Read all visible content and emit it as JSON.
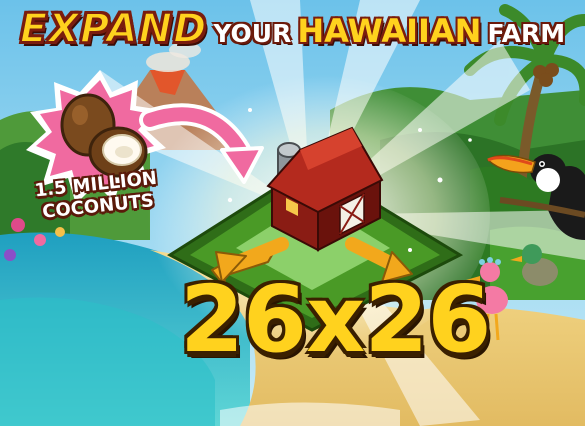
{
  "banner": {
    "title_expand": "EXPAND",
    "title_your": "YOUR",
    "title_hawaiian": "HAWAIIAN",
    "title_farm": "FARM"
  },
  "reward": {
    "line1": "1.5 MILLION",
    "line2": "COCONUTS",
    "icon": "coconut-icon"
  },
  "farm": {
    "size_label": "26x26",
    "icon": "barn-icon"
  },
  "colors": {
    "title_fill": "#ffd21e",
    "title_outline": "#7a1d0e",
    "burst": "#f06aa0",
    "arrow": "#f2a81c",
    "grass": "#3f8a1f",
    "barn": "#8a1c14",
    "ocean": "#1fb1c9"
  }
}
